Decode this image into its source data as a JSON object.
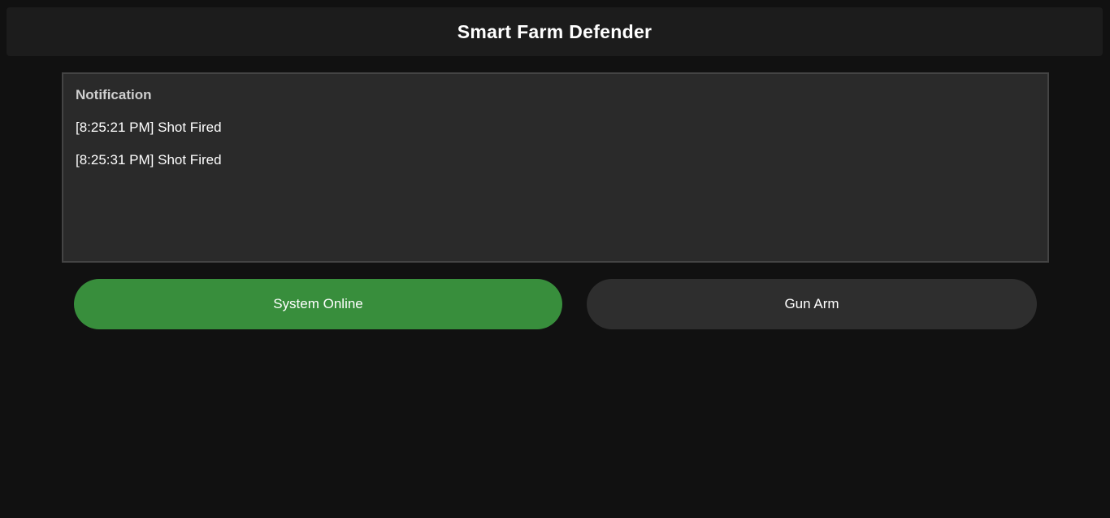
{
  "header": {
    "title": "Smart Farm Defender"
  },
  "notification": {
    "heading": "Notification",
    "items": [
      "[8:25:21 PM] Shot Fired",
      "[8:25:31 PM] Shot Fired"
    ]
  },
  "controls": {
    "system_online_label": "System Online",
    "gun_arm_label": "Gun Arm"
  },
  "colors": {
    "background": "#111111",
    "header_bg": "#1c1c1c",
    "panel_bg": "#2a2a2a",
    "online_green": "#388e3c",
    "arm_button_bg": "#2e2e2e"
  }
}
